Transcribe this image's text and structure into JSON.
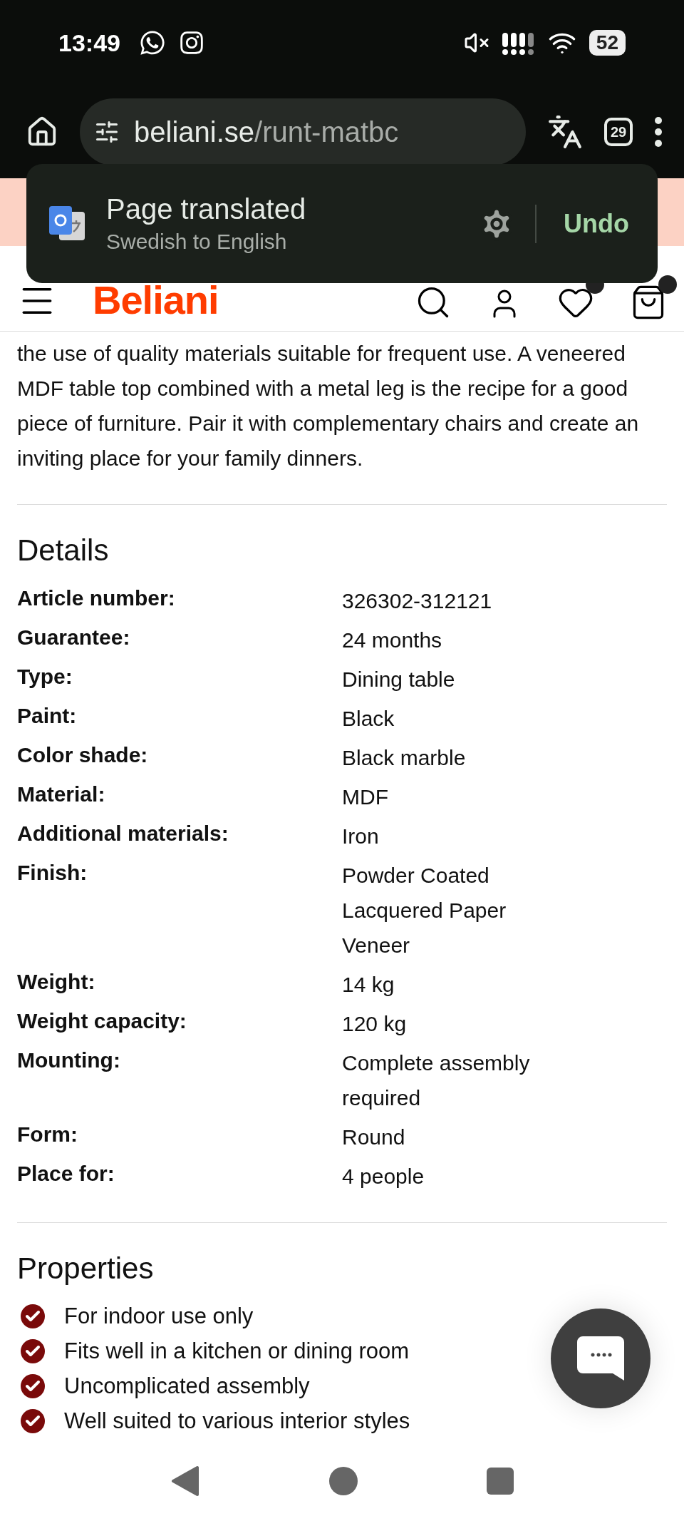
{
  "status_bar": {
    "time": "13:49",
    "battery": "52"
  },
  "browser": {
    "url_domain": "beliani.se",
    "url_path": "/runt-matbc",
    "tab_count": "29"
  },
  "translate_toast": {
    "title": "Page translated",
    "subtitle": "Swedish to English",
    "action": "Undo"
  },
  "site_header": {
    "logo": "Beliani"
  },
  "description": "the use of quality materials suitable for frequent use. A veneered MDF table top combined with a metal leg is the recipe for a good piece of furniture. Pair it with complementary chairs and create an inviting place for your family dinners.",
  "details": {
    "title": "Details",
    "rows": [
      {
        "label": "Article number:",
        "value": "326302-312121"
      },
      {
        "label": "Guarantee:",
        "value": "24 months"
      },
      {
        "label": "Type:",
        "value": "Dining table"
      },
      {
        "label": "Paint:",
        "value": "Black"
      },
      {
        "label": "Color shade:",
        "value": "Black marble"
      },
      {
        "label": "Material:",
        "value": "MDF"
      },
      {
        "label": "Additional materials:",
        "value": "Iron"
      },
      {
        "label": "Finish:",
        "values": [
          "Powder Coated",
          "Lacquered Paper",
          "Veneer"
        ]
      },
      {
        "label": "Weight:",
        "value": "14 kg"
      },
      {
        "label": "Weight capacity:",
        "value": "120 kg"
      },
      {
        "label": "Mounting:",
        "value": "Complete assembly required"
      },
      {
        "label": "Form:",
        "value": "Round"
      },
      {
        "label": "Place for:",
        "value": "4 people"
      }
    ]
  },
  "properties": {
    "title": "Properties",
    "items": [
      "For indoor use only",
      "Fits well in a kitchen or dining room",
      "Uncomplicated assembly",
      "Well suited to various interior styles"
    ]
  }
}
